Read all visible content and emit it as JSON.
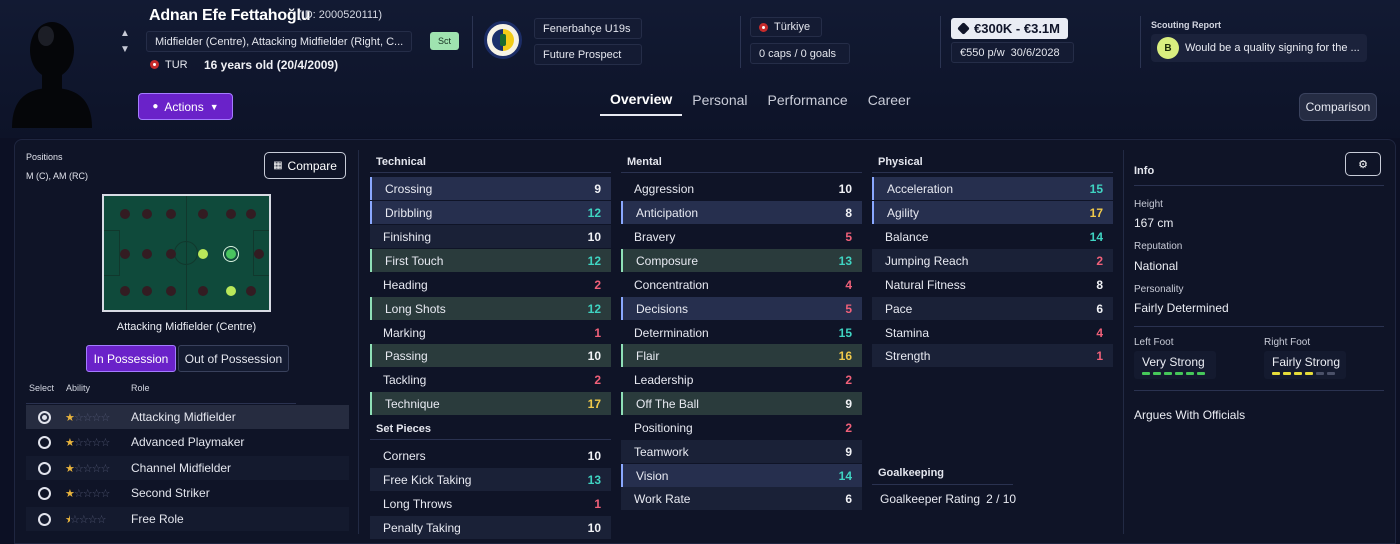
{
  "player": {
    "name": "Adnan Efe Fettahoğlu",
    "id_text": "(ID: 2000520111)",
    "positions_text": "Midfielder (Centre), Attacking Midfielder (Right, C...",
    "nationality_code": "TUR",
    "age_text": "16 years old (20/4/2009)",
    "sct_badge": "Sct"
  },
  "club": {
    "name": "Fenerbahçe U19s",
    "status": "Future Prospect"
  },
  "international": {
    "country": "Türkiye",
    "caps": "0 caps / 0 goals"
  },
  "value": {
    "range": "€300K - €3.1M",
    "wage": "€550 p/w",
    "contract_end": "30/6/2028"
  },
  "scouting": {
    "label": "Scouting Report",
    "grade": "B",
    "summary": "Would be a quality signing for the ..."
  },
  "actions_label": "Actions",
  "tabs": [
    {
      "label": "Overview",
      "active": true
    },
    {
      "label": "Personal",
      "active": false
    },
    {
      "label": "Performance",
      "active": false
    },
    {
      "label": "Career",
      "active": false
    }
  ],
  "comparison_label": "Comparison",
  "positions_panel": {
    "label": "Positions",
    "value": "M (C), AM (RC)",
    "compare_label": "Compare",
    "selected_position": "Attacking Midfielder (Centre)",
    "in_possession": "In Possession",
    "out_of_possession": "Out of Possession",
    "headers": {
      "select": "Select",
      "ability": "Ability",
      "role": "Role"
    },
    "roles": [
      {
        "name": "Attacking Midfielder",
        "stars": 1,
        "selected": true
      },
      {
        "name": "Advanced Playmaker",
        "stars": 1,
        "selected": false
      },
      {
        "name": "Channel Midfielder",
        "stars": 1,
        "selected": false
      },
      {
        "name": "Second Striker",
        "stars": 1,
        "selected": false
      },
      {
        "name": "Free Role",
        "stars": 0.5,
        "selected": false
      }
    ]
  },
  "technical": {
    "title": "Technical",
    "items": [
      {
        "name": "Crossing",
        "value": "9"
      },
      {
        "name": "Dribbling",
        "value": "12"
      },
      {
        "name": "Finishing",
        "value": "10"
      },
      {
        "name": "First Touch",
        "value": "12"
      },
      {
        "name": "Heading",
        "value": "2"
      },
      {
        "name": "Long Shots",
        "value": "12"
      },
      {
        "name": "Marking",
        "value": "1"
      },
      {
        "name": "Passing",
        "value": "10"
      },
      {
        "name": "Tackling",
        "value": "2"
      },
      {
        "name": "Technique",
        "value": "17"
      }
    ]
  },
  "set_pieces": {
    "title": "Set Pieces",
    "items": [
      {
        "name": "Corners",
        "value": "10"
      },
      {
        "name": "Free Kick Taking",
        "value": "13"
      },
      {
        "name": "Long Throws",
        "value": "1"
      },
      {
        "name": "Penalty Taking",
        "value": "10"
      }
    ]
  },
  "mental": {
    "title": "Mental",
    "items": [
      {
        "name": "Aggression",
        "value": "10"
      },
      {
        "name": "Anticipation",
        "value": "8"
      },
      {
        "name": "Bravery",
        "value": "5"
      },
      {
        "name": "Composure",
        "value": "13"
      },
      {
        "name": "Concentration",
        "value": "4"
      },
      {
        "name": "Decisions",
        "value": "5"
      },
      {
        "name": "Determination",
        "value": "15"
      },
      {
        "name": "Flair",
        "value": "16"
      },
      {
        "name": "Leadership",
        "value": "2"
      },
      {
        "name": "Off The Ball",
        "value": "9"
      },
      {
        "name": "Positioning",
        "value": "2"
      },
      {
        "name": "Teamwork",
        "value": "9"
      },
      {
        "name": "Vision",
        "value": "14"
      },
      {
        "name": "Work Rate",
        "value": "6"
      }
    ]
  },
  "physical": {
    "title": "Physical",
    "items": [
      {
        "name": "Acceleration",
        "value": "15"
      },
      {
        "name": "Agility",
        "value": "17"
      },
      {
        "name": "Balance",
        "value": "14"
      },
      {
        "name": "Jumping Reach",
        "value": "2"
      },
      {
        "name": "Natural Fitness",
        "value": "8"
      },
      {
        "name": "Pace",
        "value": "6"
      },
      {
        "name": "Stamina",
        "value": "4"
      },
      {
        "name": "Strength",
        "value": "1"
      }
    ]
  },
  "goalkeeping": {
    "title": "Goalkeeping",
    "rating_label": "Goalkeeper Rating",
    "rating_value": "2 / 10"
  },
  "info": {
    "title": "Info",
    "height_label": "Height",
    "height": "167 cm",
    "reputation_label": "Reputation",
    "reputation": "National",
    "personality_label": "Personality",
    "personality": "Fairly Determined",
    "left_foot_label": "Left Foot",
    "left_foot": "Very Strong",
    "right_foot_label": "Right Foot",
    "right_foot": "Fairly Strong",
    "trait": "Argues With Officials"
  },
  "colors": {
    "accent": "#6a22c9",
    "value_green": "#3fd4c2",
    "value_red": "#f06079",
    "value_yellow": "#f0c94a"
  }
}
